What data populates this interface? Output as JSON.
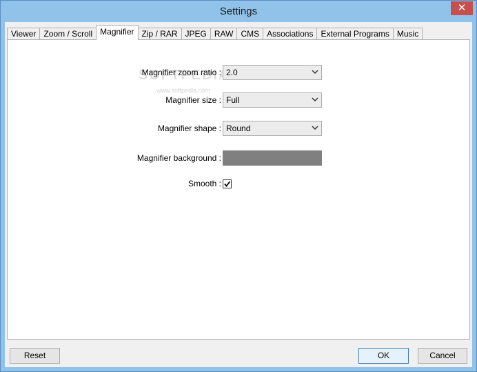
{
  "window": {
    "title": "Settings",
    "close_glyph": "✕"
  },
  "tabs": [
    {
      "label": "Viewer"
    },
    {
      "label": "Zoom / Scroll"
    },
    {
      "label": "Magnifier",
      "active": true
    },
    {
      "label": "Zip / RAR"
    },
    {
      "label": "JPEG"
    },
    {
      "label": "RAW"
    },
    {
      "label": "CMS"
    },
    {
      "label": "Associations"
    },
    {
      "label": "External Programs"
    },
    {
      "label": "Music"
    }
  ],
  "magnifier": {
    "zoom_ratio": {
      "label": "Magnifier zoom ratio :",
      "value": "2.0"
    },
    "size": {
      "label": "Magnifier size :",
      "value": "Full"
    },
    "shape": {
      "label": "Magnifier shape :",
      "value": "Round"
    },
    "background": {
      "label": "Magnifier background :",
      "color": "#808080"
    },
    "smooth": {
      "label": "Smooth :",
      "checked": true
    }
  },
  "watermark": {
    "text": "SOFTPEDIA",
    "sub": "www.softpedia.com"
  },
  "footer": {
    "reset_label": "Reset",
    "ok_label": "OK",
    "cancel_label": "Cancel"
  }
}
